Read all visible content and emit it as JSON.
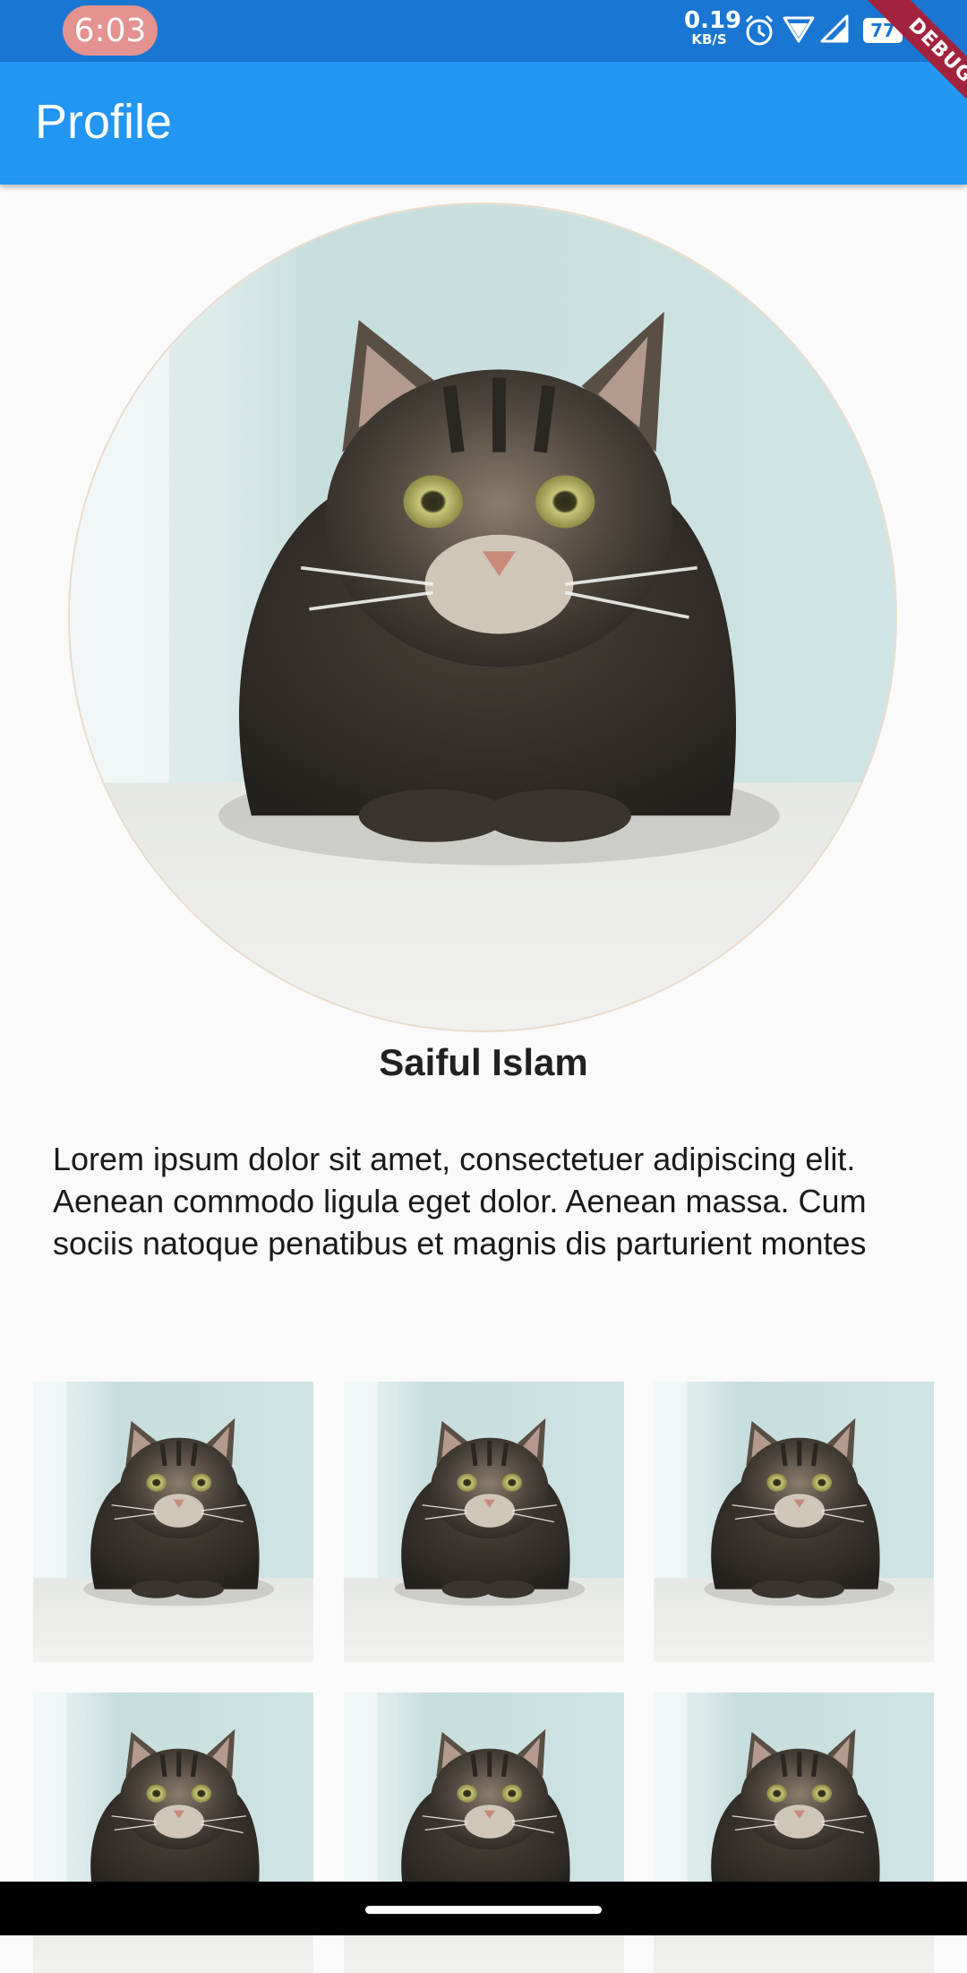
{
  "status_bar": {
    "time": "6:03",
    "net_speed_value": "0.19",
    "net_speed_unit": "KB/S",
    "battery_level": "77",
    "icons": [
      "alarm-icon",
      "wifi-icon",
      "signal-icon",
      "battery-icon"
    ]
  },
  "app_bar": {
    "title": "Profile",
    "debug_banner": "DEBUG"
  },
  "profile": {
    "name": "Saiful Islam",
    "bio": "Lorem ipsum dolor sit amet, consectetuer adipiscing elit. Aenean commodo ligula eget dolor. Aenean massa. Cum sociis natoque penatibus et magnis dis parturient montes"
  },
  "gallery": {
    "image_subject": "cat photo",
    "count": 6
  },
  "colors": {
    "app_bar": "#2196f3",
    "status_bar": "#1976d2",
    "debug_banner": "#a3233e"
  }
}
